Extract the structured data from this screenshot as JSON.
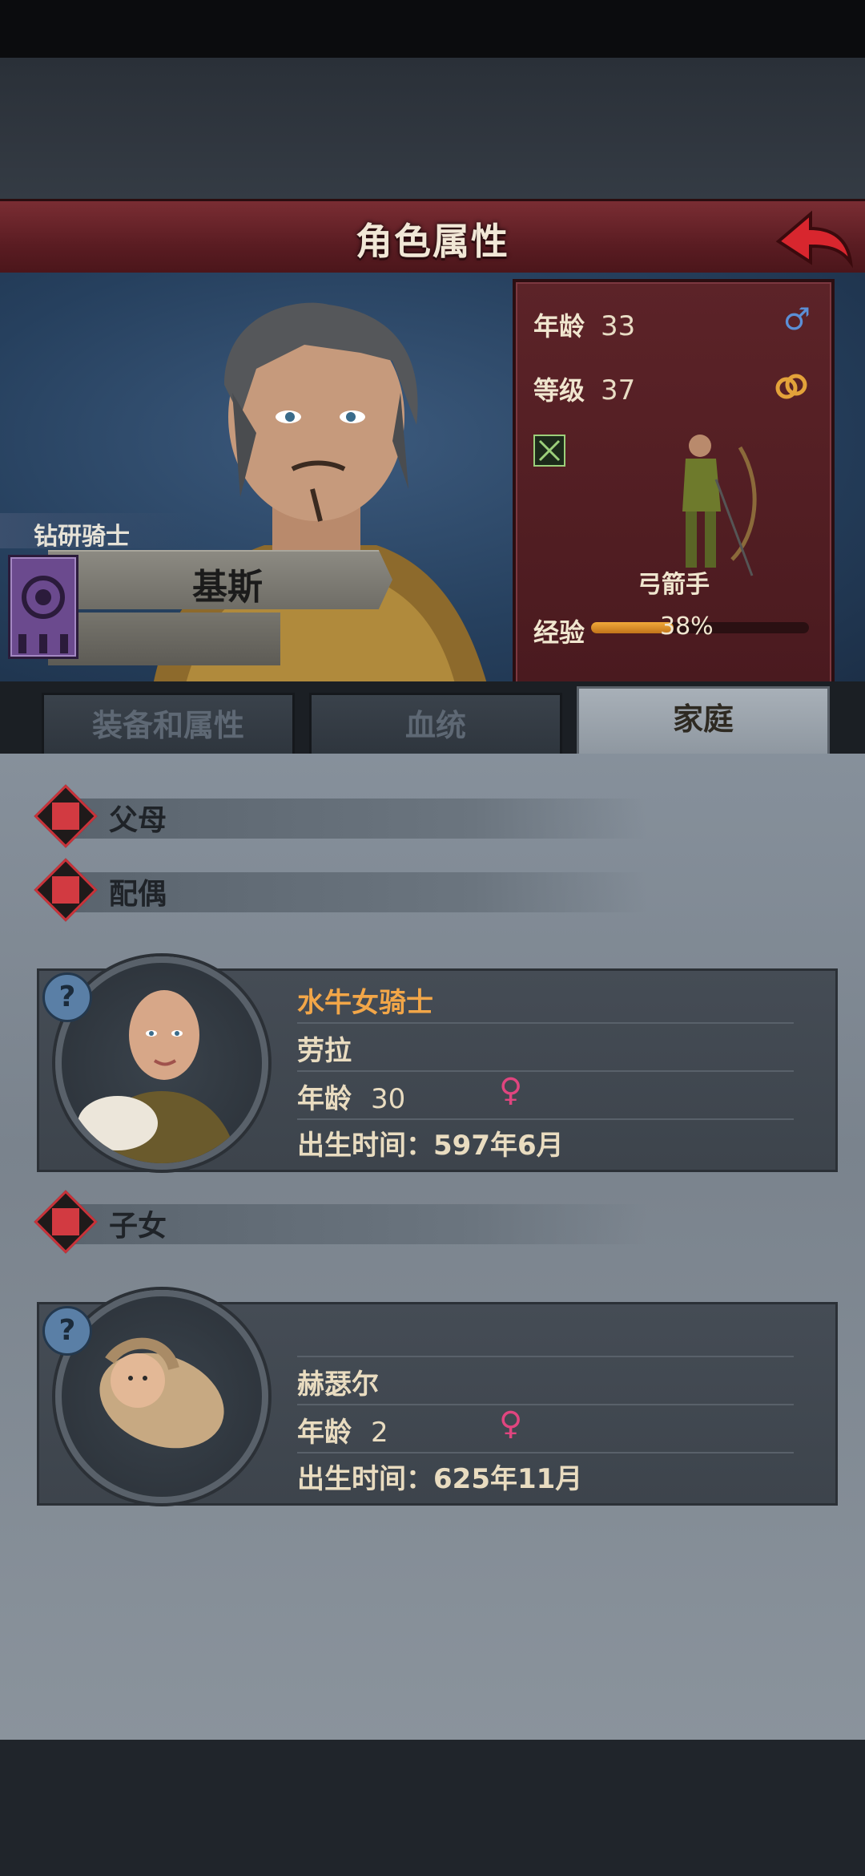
{
  "header": {
    "title": "角色属性"
  },
  "hero": {
    "rank": "钻研骑士",
    "name": "基斯"
  },
  "stats": {
    "age_label": "年龄",
    "age": "33",
    "level_label": "等级",
    "level": "37",
    "class_name": "弓箭手",
    "exp_label": "经验",
    "exp_text": "38%",
    "exp_fraction": 0.38,
    "gender_icon": "male-icon",
    "marriage_icon": "rings-icon"
  },
  "tabs": [
    {
      "label": "装备和属性",
      "active": false
    },
    {
      "label": "血统",
      "active": false
    },
    {
      "label": "家庭",
      "active": true
    }
  ],
  "family": {
    "parents_label": "父母",
    "spouse_label": "配偶",
    "children_label": "子女",
    "spouse": {
      "title": "水牛女骑士",
      "name": "劳拉",
      "age_label": "年龄",
      "age": "30",
      "birth": "出生时间：597年6月"
    },
    "child": {
      "name": "赫瑟尔",
      "age_label": "年龄",
      "age": "2",
      "birth": "出生时间：625年11月"
    },
    "unknown_badge": "?"
  },
  "colors": {
    "title_bar": "#5a1c22",
    "accent_gold": "#f2a648",
    "female": "#e0457f",
    "male": "#5b8fd6"
  }
}
